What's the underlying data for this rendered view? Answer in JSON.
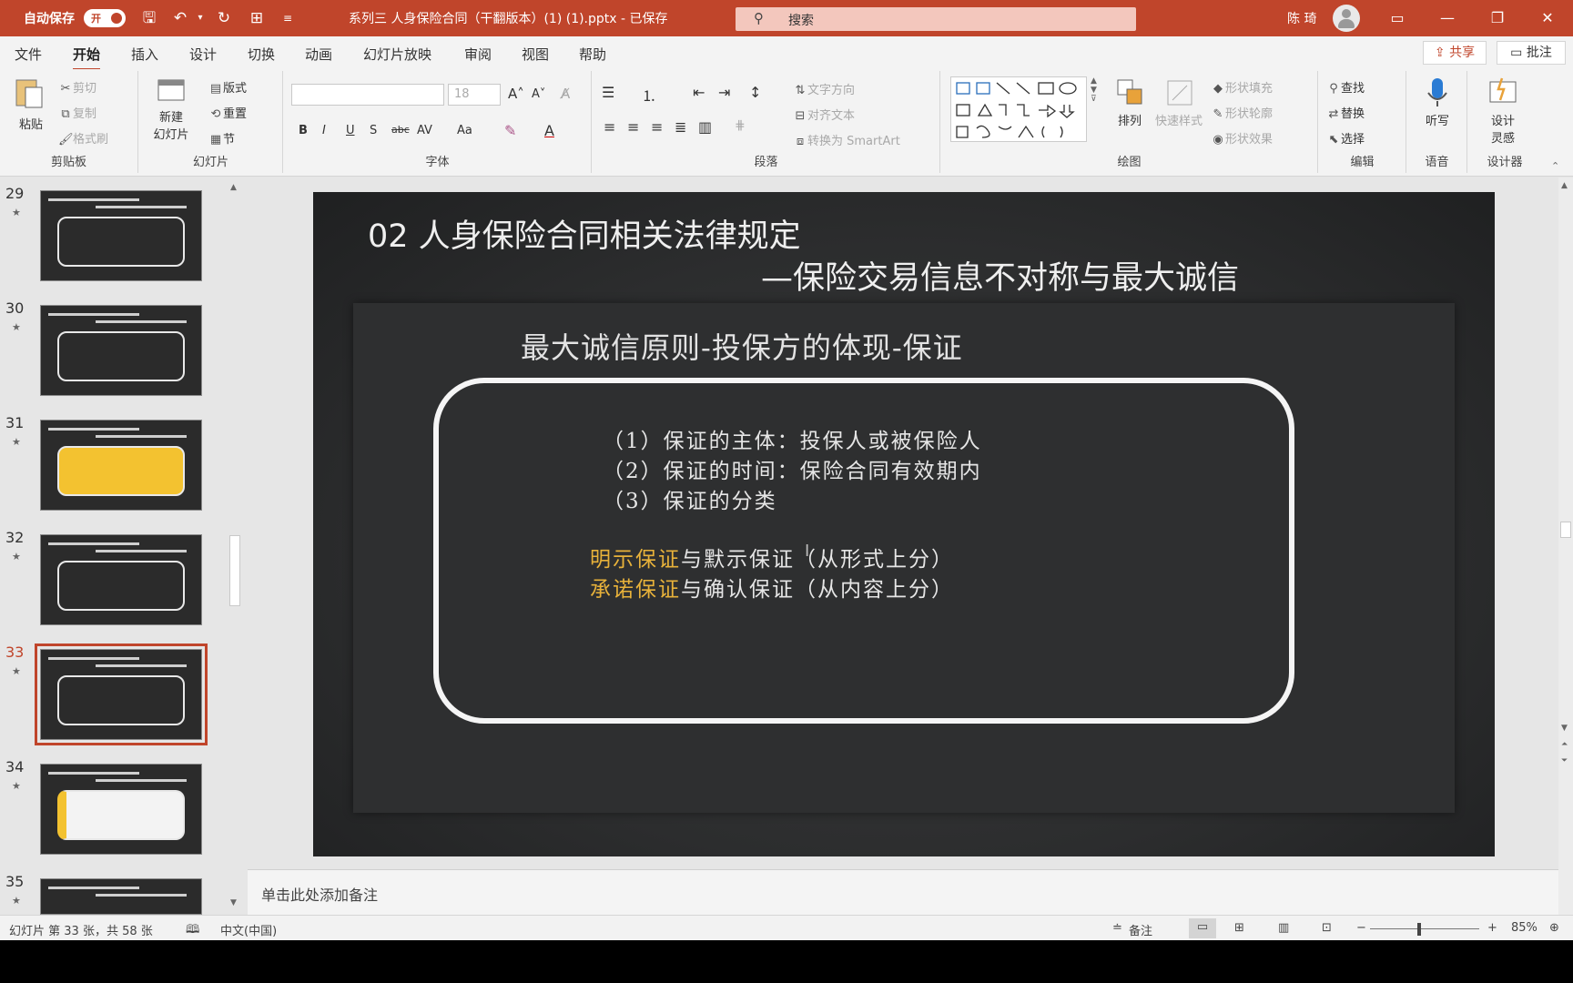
{
  "titlebar": {
    "autosave_label": "自动保存",
    "autosave_state": "开",
    "filename": "系列三 人身保险合同（干翻版本）(1) (1).pptx - 已保存",
    "search_placeholder": "搜索",
    "user": "陈 琦"
  },
  "menu": {
    "tabs": [
      "文件",
      "开始",
      "插入",
      "设计",
      "切换",
      "动画",
      "幻灯片放映",
      "审阅",
      "视图",
      "帮助"
    ],
    "active": "开始",
    "share": "共享",
    "comment": "批注"
  },
  "ribbon": {
    "clipboard": {
      "paste": "粘贴",
      "cut": "剪切",
      "copy": "复制",
      "format_painter": "格式刷",
      "label": "剪贴板"
    },
    "slides": {
      "new_slide": "新建",
      "new_slide2": "幻灯片",
      "layout": "版式",
      "reset": "重置",
      "section": "节",
      "label": "幻灯片"
    },
    "font": {
      "size": "18",
      "bold": "B",
      "italic": "I",
      "underline": "U",
      "shadow": "S",
      "strike": "abc",
      "spacing": "AV",
      "case": "Aa",
      "label": "字体"
    },
    "paragraph": {
      "text_direction": "文字方向",
      "align_text": "对齐文本",
      "smartart": "转换为 SmartArt",
      "label": "段落"
    },
    "drawing": {
      "arrange": "排列",
      "quick_styles": "快速样式",
      "shape_fill": "形状填充",
      "shape_outline": "形状轮廓",
      "shape_effects": "形状效果",
      "label": "绘图"
    },
    "editing": {
      "find": "查找",
      "replace": "替换",
      "select": "选择",
      "label": "编辑"
    },
    "voice": {
      "dictate": "听写",
      "label": "语音"
    },
    "designer": {
      "ideas": "设计",
      "ideas2": "灵感",
      "label": "设计器"
    }
  },
  "thumbnails": [
    {
      "num": "29",
      "star": "★"
    },
    {
      "num": "30",
      "star": "★"
    },
    {
      "num": "31",
      "star": "★"
    },
    {
      "num": "32",
      "star": "★"
    },
    {
      "num": "33",
      "star": "★"
    },
    {
      "num": "34",
      "star": "★"
    },
    {
      "num": "35",
      "star": "★"
    }
  ],
  "slide": {
    "title": "02  人身保险合同相关法律规定",
    "subtitle": "—保险交易信息不对称与最大诚信",
    "heading": "最大诚信原则-投保方的体现-保证",
    "points": [
      "（1）保证的主体：投保人或被保险人",
      "（2）保证的时间：保险合同有效期内",
      "（3）保证的分类"
    ],
    "pair1_gold": "明示保证",
    "pair1_rest": "与默示保证（从形式上分）",
    "pair2_gold": "承诺保证",
    "pair2_rest": "与确认保证（从内容上分）",
    "accent_color": "#e8b23a"
  },
  "notes_placeholder": "单击此处添加备注",
  "status": {
    "slide_info": "幻灯片 第 33 张，共 58 张",
    "language": "中文(中国)",
    "notes": "备注",
    "zoom": "85%"
  }
}
